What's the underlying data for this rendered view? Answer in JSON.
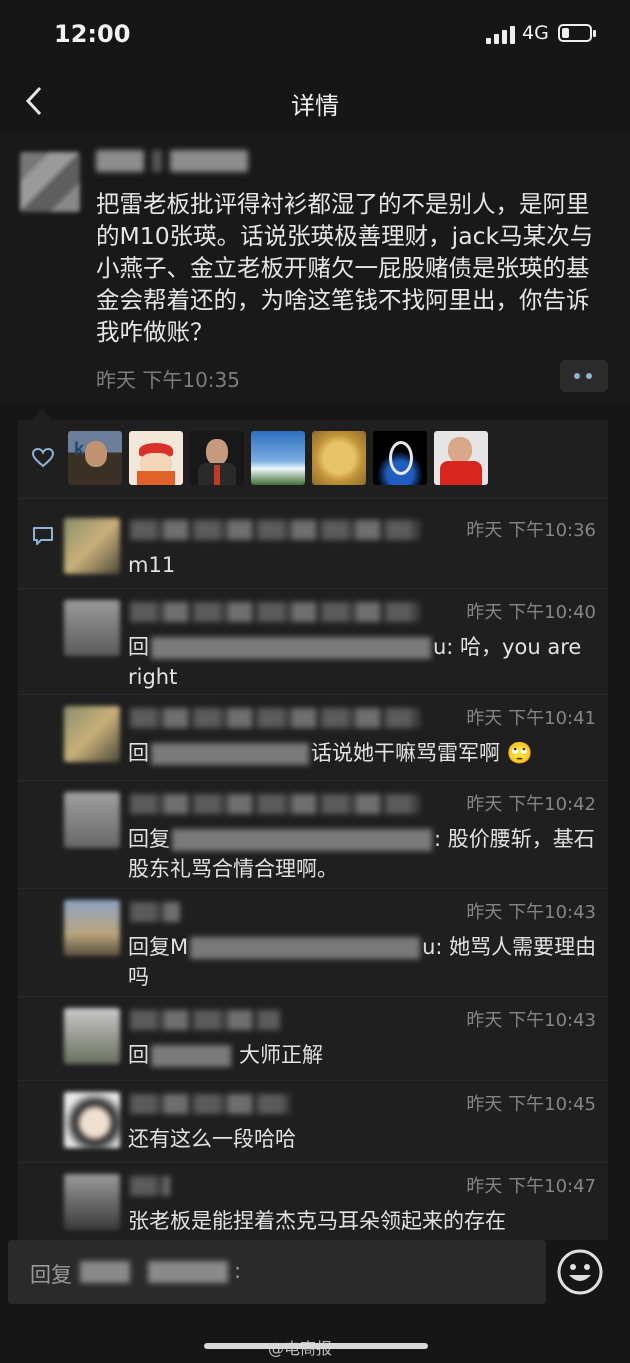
{
  "status": {
    "time": "12:00",
    "network": "4G",
    "battery_level": 0.25
  },
  "nav": {
    "title": "详情"
  },
  "post": {
    "text": "把雷老板批评得衬衫都湿了的不是别人，是阿里的M10张瑛。话说张瑛极善理财，jack马某次与小燕子、金立老板开赌欠一屁股赌债是张瑛的基金会帮着还的，为啥这笔钱不找阿里出，你告诉我咋做账？",
    "time": "昨天 下午10:35"
  },
  "comments": [
    {
      "time": "昨天 下午10:36",
      "name_start": "W",
      "name_end": "u",
      "text": "m11"
    },
    {
      "time": "昨天 下午10:40",
      "prefix": "回",
      "suffix": "u: 哈，you are right"
    },
    {
      "time": "昨天 下午10:41",
      "prefix": "回",
      "suffix": "话说她干嘛骂雷军啊 🙄"
    },
    {
      "time": "昨天 下午10:42",
      "prefix": "回复",
      "suffix": ": 股价腰斩，基石股东礼骂合情合理啊。"
    },
    {
      "time": "昨天 下午10:43",
      "prefix": "回复M",
      "suffix": "u: 她骂人需要理由吗"
    },
    {
      "time": "昨天 下午10:43",
      "prefix": "回",
      "suffix": "大师正解"
    },
    {
      "time": "昨天 下午10:45",
      "text": "还有这么一段哈哈"
    },
    {
      "time": "昨天 下午10:47",
      "text": "张老板是能捏着杰克马耳朵领起来的存在"
    }
  ],
  "input": {
    "prefix": "回复",
    "suffix": ":"
  },
  "watermark": "@电商报",
  "icons": {
    "back": "chevron-left-icon",
    "like": "heart-icon",
    "comment": "comment-icon",
    "more": "more-dots-icon",
    "emoji": "emoji-icon"
  }
}
